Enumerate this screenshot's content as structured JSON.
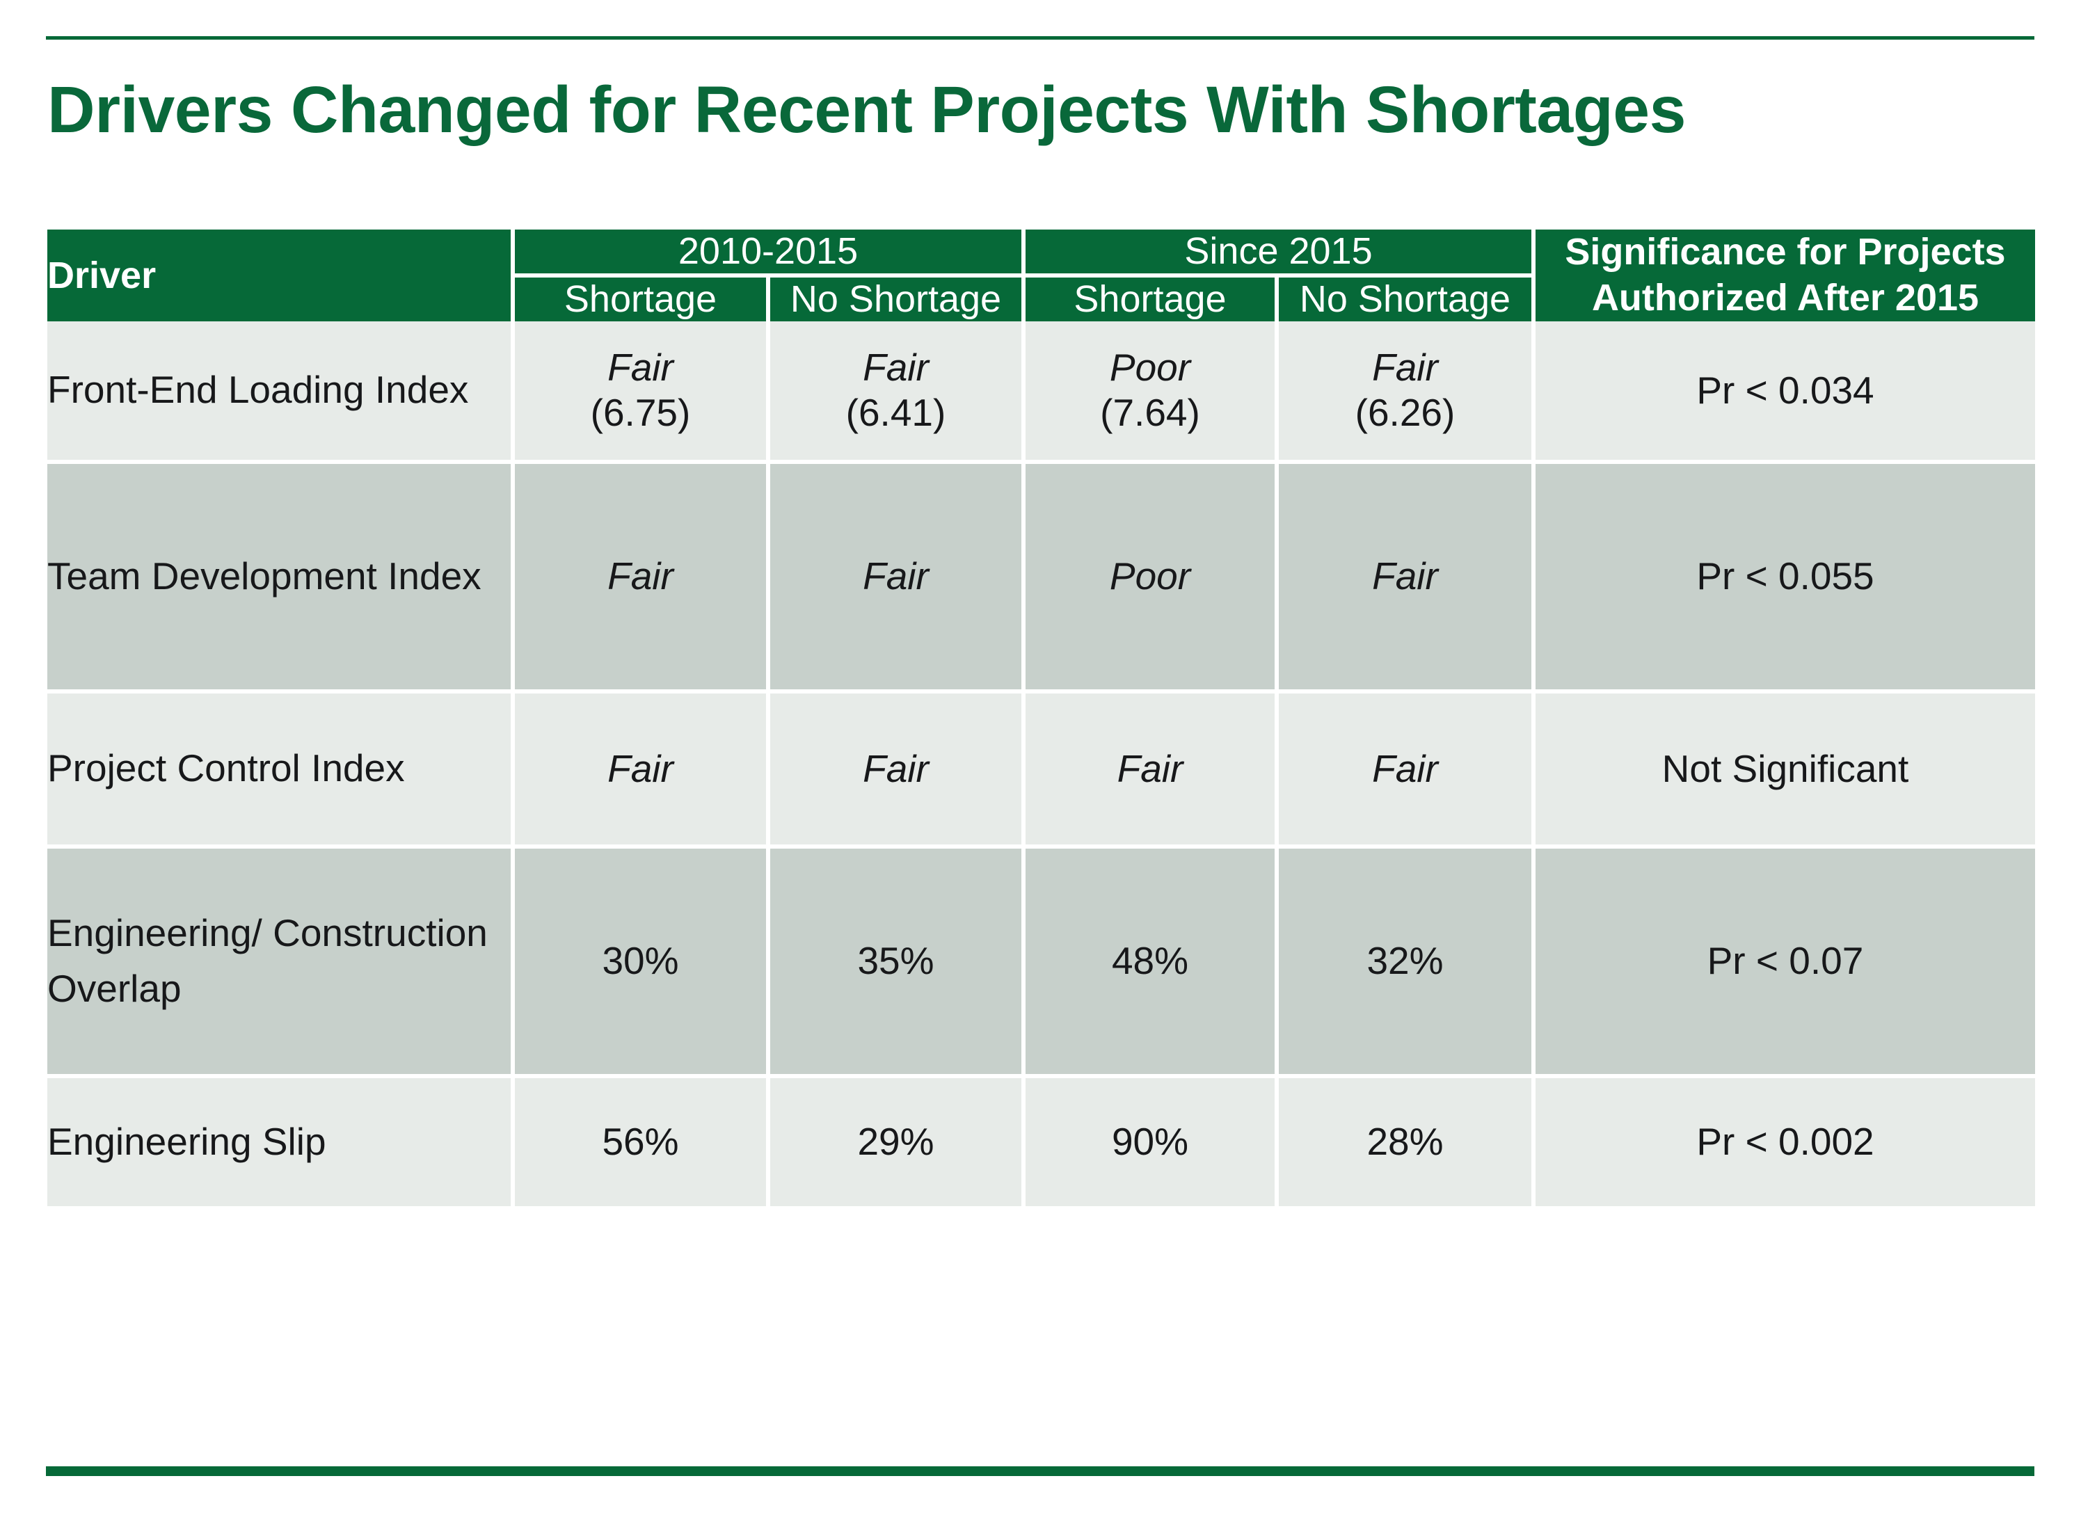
{
  "slide": {
    "title": "Drivers Changed for Recent Projects With Shortages",
    "accent_color": "#066938",
    "highlight_color": "#c00016",
    "row_light": "#e7ebe8",
    "row_dark": "#c7d0cb"
  },
  "table": {
    "corner_label": "Driver",
    "group_headers": [
      {
        "label": "2010-2015"
      },
      {
        "label": "Since 2015"
      }
    ],
    "sub_headers": [
      {
        "label": "Shortage"
      },
      {
        "label": "No Shortage"
      },
      {
        "label": "Shortage"
      },
      {
        "label": "No Shortage"
      }
    ],
    "significance_header": "Significance for Projects Authorized After 2015",
    "rows": [
      {
        "driver": "Front-End Loading Index",
        "cells": [
          {
            "rating": "Fair",
            "value": "(6.75)",
            "highlight": false
          },
          {
            "rating": "Fair",
            "value": "(6.41)",
            "highlight": false
          },
          {
            "rating": "Poor",
            "value": "(7.64)",
            "highlight": true
          },
          {
            "rating": "Fair",
            "value": "(6.26)",
            "highlight": false
          }
        ],
        "significance": "Pr < 0.034"
      },
      {
        "driver": "Team Development Index",
        "cells": [
          {
            "rating": "Fair",
            "value": "",
            "highlight": false
          },
          {
            "rating": "Fair",
            "value": "",
            "highlight": false
          },
          {
            "rating": "Poor",
            "value": "",
            "highlight": true
          },
          {
            "rating": "Fair",
            "value": "",
            "highlight": false
          }
        ],
        "significance": "Pr < 0.055"
      },
      {
        "driver": "Project Control Index",
        "cells": [
          {
            "rating": "Fair",
            "value": "",
            "highlight": false
          },
          {
            "rating": "Fair",
            "value": "",
            "highlight": false
          },
          {
            "rating": "Fair",
            "value": "",
            "highlight": false
          },
          {
            "rating": "Fair",
            "value": "",
            "highlight": false
          }
        ],
        "significance": "Not Significant"
      },
      {
        "driver": "Engineering/ Construction Overlap",
        "cells": [
          {
            "rating": "30%",
            "value": "",
            "highlight": false
          },
          {
            "rating": "35%",
            "value": "",
            "highlight": false
          },
          {
            "rating": "48%",
            "value": "",
            "highlight": true
          },
          {
            "rating": "32%",
            "value": "",
            "highlight": false
          }
        ],
        "significance": "Pr < 0.07"
      },
      {
        "driver": "Engineering Slip",
        "cells": [
          {
            "rating": "56%",
            "value": "",
            "highlight": true
          },
          {
            "rating": "29%",
            "value": "",
            "highlight": false
          },
          {
            "rating": "90%",
            "value": "",
            "highlight": true
          },
          {
            "rating": "28%",
            "value": "",
            "highlight": false
          }
        ],
        "significance": "Pr < 0.002"
      }
    ]
  }
}
